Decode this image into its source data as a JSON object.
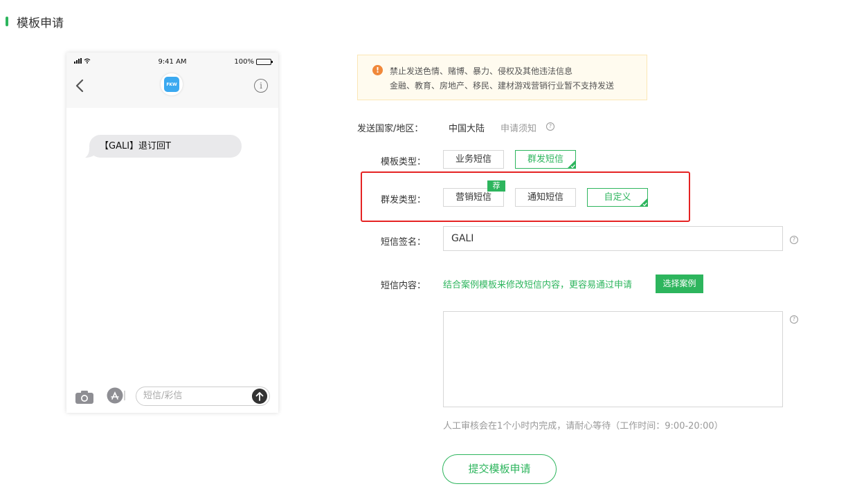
{
  "page": {
    "title": "模板申请"
  },
  "phone": {
    "status_time": "9:41 AM",
    "battery_text": "100%",
    "avatar_logo_text": "FKW",
    "info_glyph": "i",
    "message_text": "【GALI】退订回T",
    "input_placeholder": "短信/彩信"
  },
  "warning": {
    "line1": "禁止发送色情、赌博、暴力、侵权及其他违法信息",
    "line2": "金融、教育、房地产、移民、建材游戏营销行业暂不支持发送"
  },
  "form": {
    "country_label": "发送国家/地区：",
    "country_value": "中国大陆",
    "notice_link": "申请须知",
    "template_type_label": "模板类型：",
    "template_types": [
      "业务短信",
      "群发短信"
    ],
    "template_type_selected": "群发短信",
    "group_type_label": "群发类型：",
    "group_types": [
      "营销短信",
      "通知短信",
      "自定义"
    ],
    "group_type_selected": "自定义",
    "recommend_badge": "荐",
    "signature_label": "短信签名：",
    "signature_value": "GALI",
    "content_label": "短信内容：",
    "content_hint": "结合案例模板来修改短信内容，更容易通过申请",
    "choose_case_button": "选择案例",
    "review_note": "人工审核会在1个小时内完成，请耐心等待（工作时间：9:00-20:00）",
    "submit_button": "提交模板申请",
    "help_glyph": "?"
  },
  "colors": {
    "accent": "#2db55d",
    "warning_icon": "#f0883a",
    "highlight_border": "#e52222"
  }
}
